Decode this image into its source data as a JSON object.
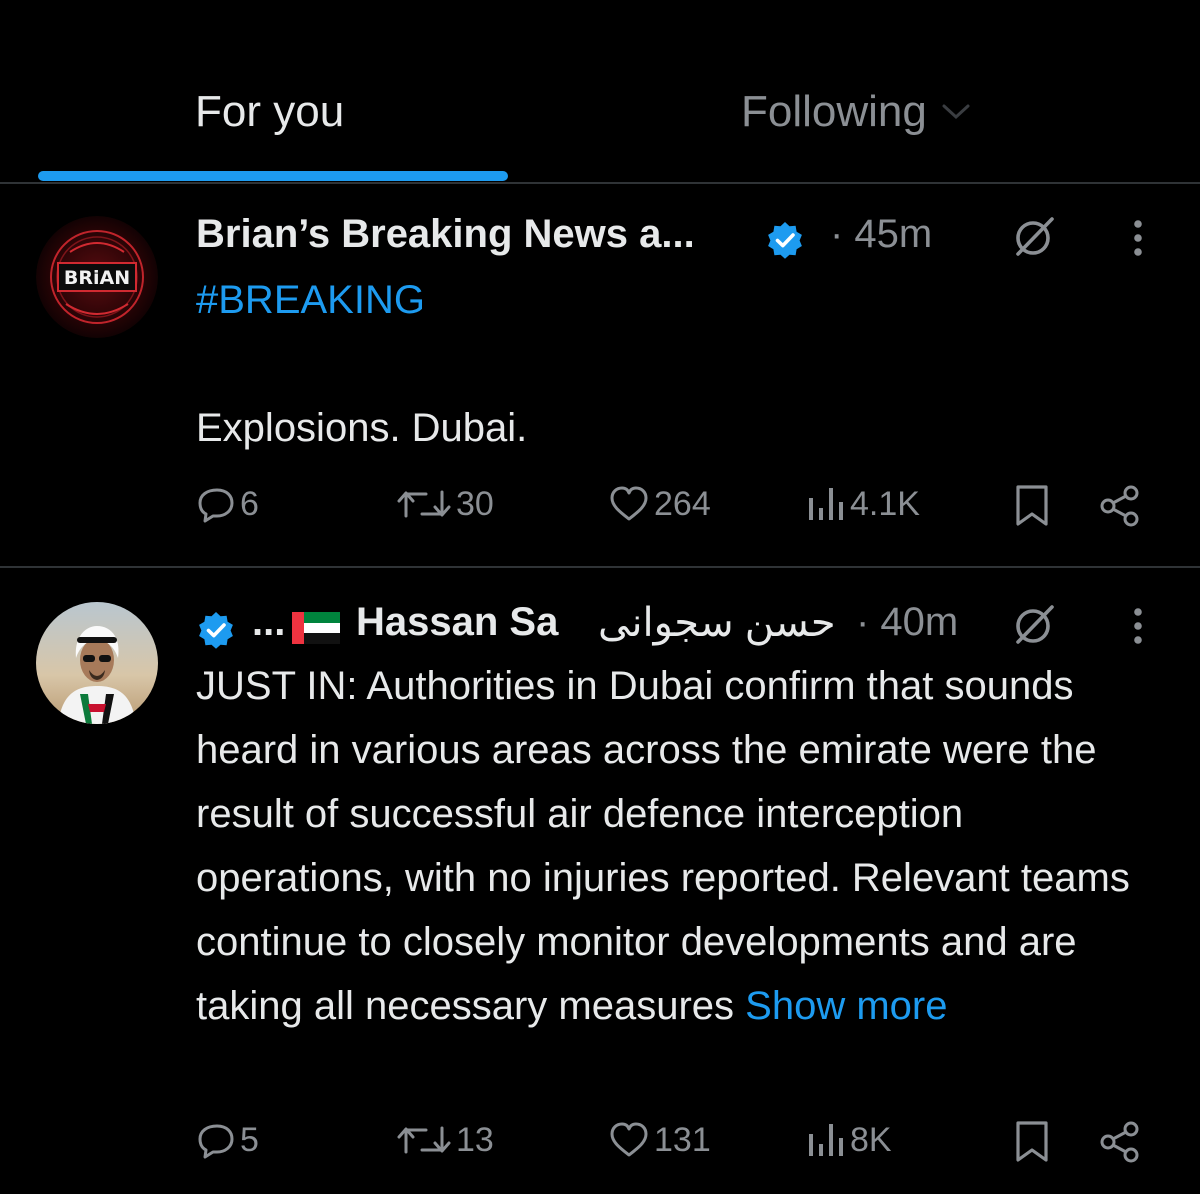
{
  "tabs": [
    {
      "label": "For you",
      "active": true
    },
    {
      "label": "Following",
      "active": false
    }
  ],
  "colors": {
    "accent": "#1d9bf0",
    "text": "#e7e9ea",
    "muted": "#8b8f94",
    "divider": "#2f3336"
  },
  "posts": [
    {
      "avatar_text": "BRiAN",
      "name": "Brian’s Breaking News a...",
      "verified": true,
      "time": "· 45m",
      "hashtag": "#BREAKING",
      "text": "Explosions. Dubai.",
      "replies": "6",
      "reposts": "30",
      "likes": "264",
      "views": "4.1K"
    },
    {
      "avatar_icon": "person-avatar-icon",
      "name_latin": "Hassan Sa",
      "name_arabic": "حسن سجوانی",
      "name_ellipsis": "...",
      "flag": "uae-flag-icon",
      "verified": true,
      "time": "· 40m",
      "text": "JUST IN: Authorities in Dubai confirm that sounds heard in various areas across the emirate were the result of successful air defence interception operations, with no injuries reported. Relevant teams continue to closely monitor developments and are taking all necessary measures",
      "show_more": "Show more",
      "replies": "5",
      "reposts": "13",
      "likes": "131",
      "views": "8K"
    }
  ]
}
